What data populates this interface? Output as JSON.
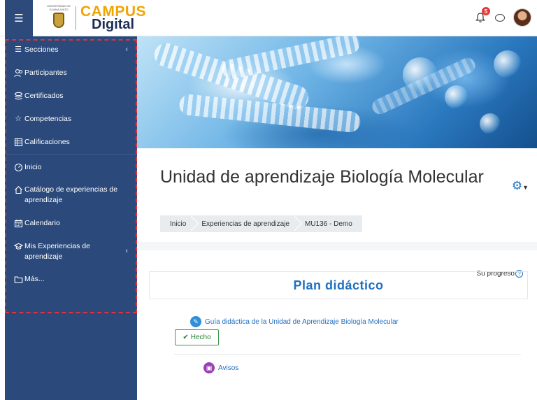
{
  "header": {
    "university_text": "UNIVERSIDAD DE GUANAJUATO",
    "logo_campus": "CAMPUS",
    "logo_digital": "Digital",
    "notification_count": "5",
    "icons": {
      "menu": "hamburger-icon",
      "bell": "bell-icon",
      "chat": "chat-bubble-icon"
    }
  },
  "sidebar": {
    "items": [
      {
        "label": "Secciones",
        "icon": "list-icon"
      },
      {
        "label": "Participantes",
        "icon": "users-icon"
      },
      {
        "label": "Certificados",
        "icon": "layers-icon"
      },
      {
        "label": "Competencias",
        "icon": "star-icon"
      },
      {
        "label": "Calificaciones",
        "icon": "gradebook-icon"
      },
      {
        "label": "Inicio",
        "icon": "home-dial-icon"
      },
      {
        "label": "Catálogo de experiencias de aprendizaje",
        "icon": "house-icon"
      },
      {
        "label": "Calendario",
        "icon": "calendar-icon"
      },
      {
        "label": "Mis Experiencias de aprendizaje",
        "icon": "graduation-cap-icon"
      },
      {
        "label": "Más...",
        "icon": "folder-icon"
      }
    ]
  },
  "course": {
    "title": "Unidad de aprendizaje Biología Molecular",
    "breadcrumb": [
      "Inicio",
      "Experiencias de aprendizaje",
      "MU136 - Demo"
    ]
  },
  "section": {
    "title": "Plan didáctico",
    "progress_label": "Su progreso",
    "activities": [
      {
        "label": "Guía didáctica de la Unidad de Aprendizaje Biología Molecular",
        "icon": "book-icon",
        "icon_color": "#2f8fd8"
      },
      {
        "label": "Avisos",
        "icon": "forum-icon",
        "icon_color": "#9b3fb5"
      }
    ],
    "done_label": "Hecho"
  },
  "colors": {
    "sidebar_bg": "#2b4a7b",
    "accent": "#1f6fbf",
    "highlight_border": "#e0323a",
    "done_green": "#2a7f37"
  }
}
